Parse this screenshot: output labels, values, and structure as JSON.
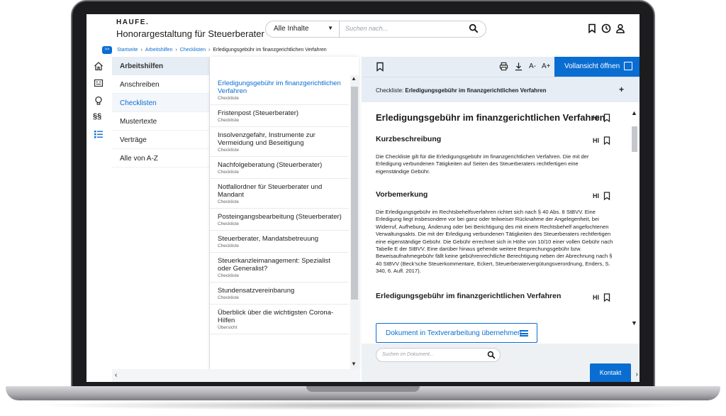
{
  "header": {
    "logo": "HAUFE.",
    "title": "Honorargestaltung für Steuerberater",
    "search_scope": "Alle Inhalte",
    "search_placeholder": "Suchen nach..."
  },
  "breadcrumb": {
    "toggle": ">>",
    "items": [
      "Startseite",
      "Arbeitshilfen",
      "Checklisten"
    ],
    "current": "Erledigungsgebühr im finanzgerichtlichen Verfahren"
  },
  "nav1": {
    "heading": "Arbeitshilfen",
    "items": [
      "Anschreiben",
      "Checklisten",
      "Mustertexte",
      "Verträge",
      "Alle von A-Z"
    ]
  },
  "nav2": {
    "items": [
      {
        "title": "Erledigungsgebühr im finanzgerichtlichen Verfahren",
        "type": "Checkliste"
      },
      {
        "title": "Fristenpost (Steuerberater)",
        "type": "Checkliste"
      },
      {
        "title": "Insolvenzgefahr, Instrumente zur Vermeidung und Beseitigung",
        "type": "Checkliste"
      },
      {
        "title": "Nachfolgeberatung (Steuerberater)",
        "type": "Checkliste"
      },
      {
        "title": "Notfallordner für Steuerberater und Mandant",
        "type": "Checkliste"
      },
      {
        "title": "Posteingangsbearbeitung (Steuerberater)",
        "type": "Checkliste"
      },
      {
        "title": "Steuerberater, Mandatsbetreuung",
        "type": "Checkliste"
      },
      {
        "title": "Steuerkanzleimanagement: Spezialist oder Generalist?",
        "type": "Checkliste"
      },
      {
        "title": "Stundensatzvereinbarung",
        "type": "Checkliste"
      },
      {
        "title": "Überblick über die wichtigsten Corona-Hilfen",
        "type": "Übersicht"
      }
    ]
  },
  "toolbar": {
    "font_smaller": "A-",
    "font_larger": "A+",
    "fullview_label": "Vollansicht öffnen"
  },
  "checklist_bar": {
    "prefix": "Checkliste:",
    "title": "Erledigungsgebühr im finanzgerichtlichen Verfahren",
    "expand": "+"
  },
  "document": {
    "title": "Erledigungsgebühr im finanzgerichtlichen Verfahren",
    "highlight_label": "HI",
    "section1_heading": "Kurzbeschreibung",
    "section1_text": "Die Checkliste gilt für die Erledigungsgebühr im finanzgerichtlichen Verfahren. Die mit der Erledigung verbundenen Tätigkeiten auf Seiten des Steuerberaters rechtfertigen eine eigenständige Gebühr.",
    "section2_heading": "Vorbemerkung",
    "section2_text": "Die Erledigungsgebühr im Rechtsbehelfsverfahren richtet sich nach § 40 Abs. 8 StBVV. Eine Erledigung liegt insbesondere vor bei ganz oder teilweiser Rücknahme der Angelegenheit, bei Widerruf, Aufhebung, Änderung oder bei Berichtigung des mit einem Rechtsbehelf angefochtenen Verwaltungsakts. Die mit der Erledigung verbundenen Tätigkeiten des Steuerberaters rechtfertigen eine eigenständige Gebühr. Die Gebühr errechnet sich in Höhe von 10/10 einer vollen Gebühr nach Tabelle E der StBVV. Eine darüber hinaus gehende weitere Besprechungsgebühr bzw. Beweisaufnahmegebühr fällt keine gebührenrechtliche Berechtigung neben der Abrechnung nach § 40 StBVV (Beck'sche Steuerkommentare, Eckert, Steuerberatervergütungsverordnung, Enders, S. 340, 6. Aufl. 2017).",
    "section3_heading": "Erledigungsgebühr im finanzgerichtlichen Verfahren",
    "export_button": "Dokument in Textverarbeitung übernehmen",
    "search_placeholder": "Suchen im Dokument..."
  },
  "contact_label": "Kontakt"
}
